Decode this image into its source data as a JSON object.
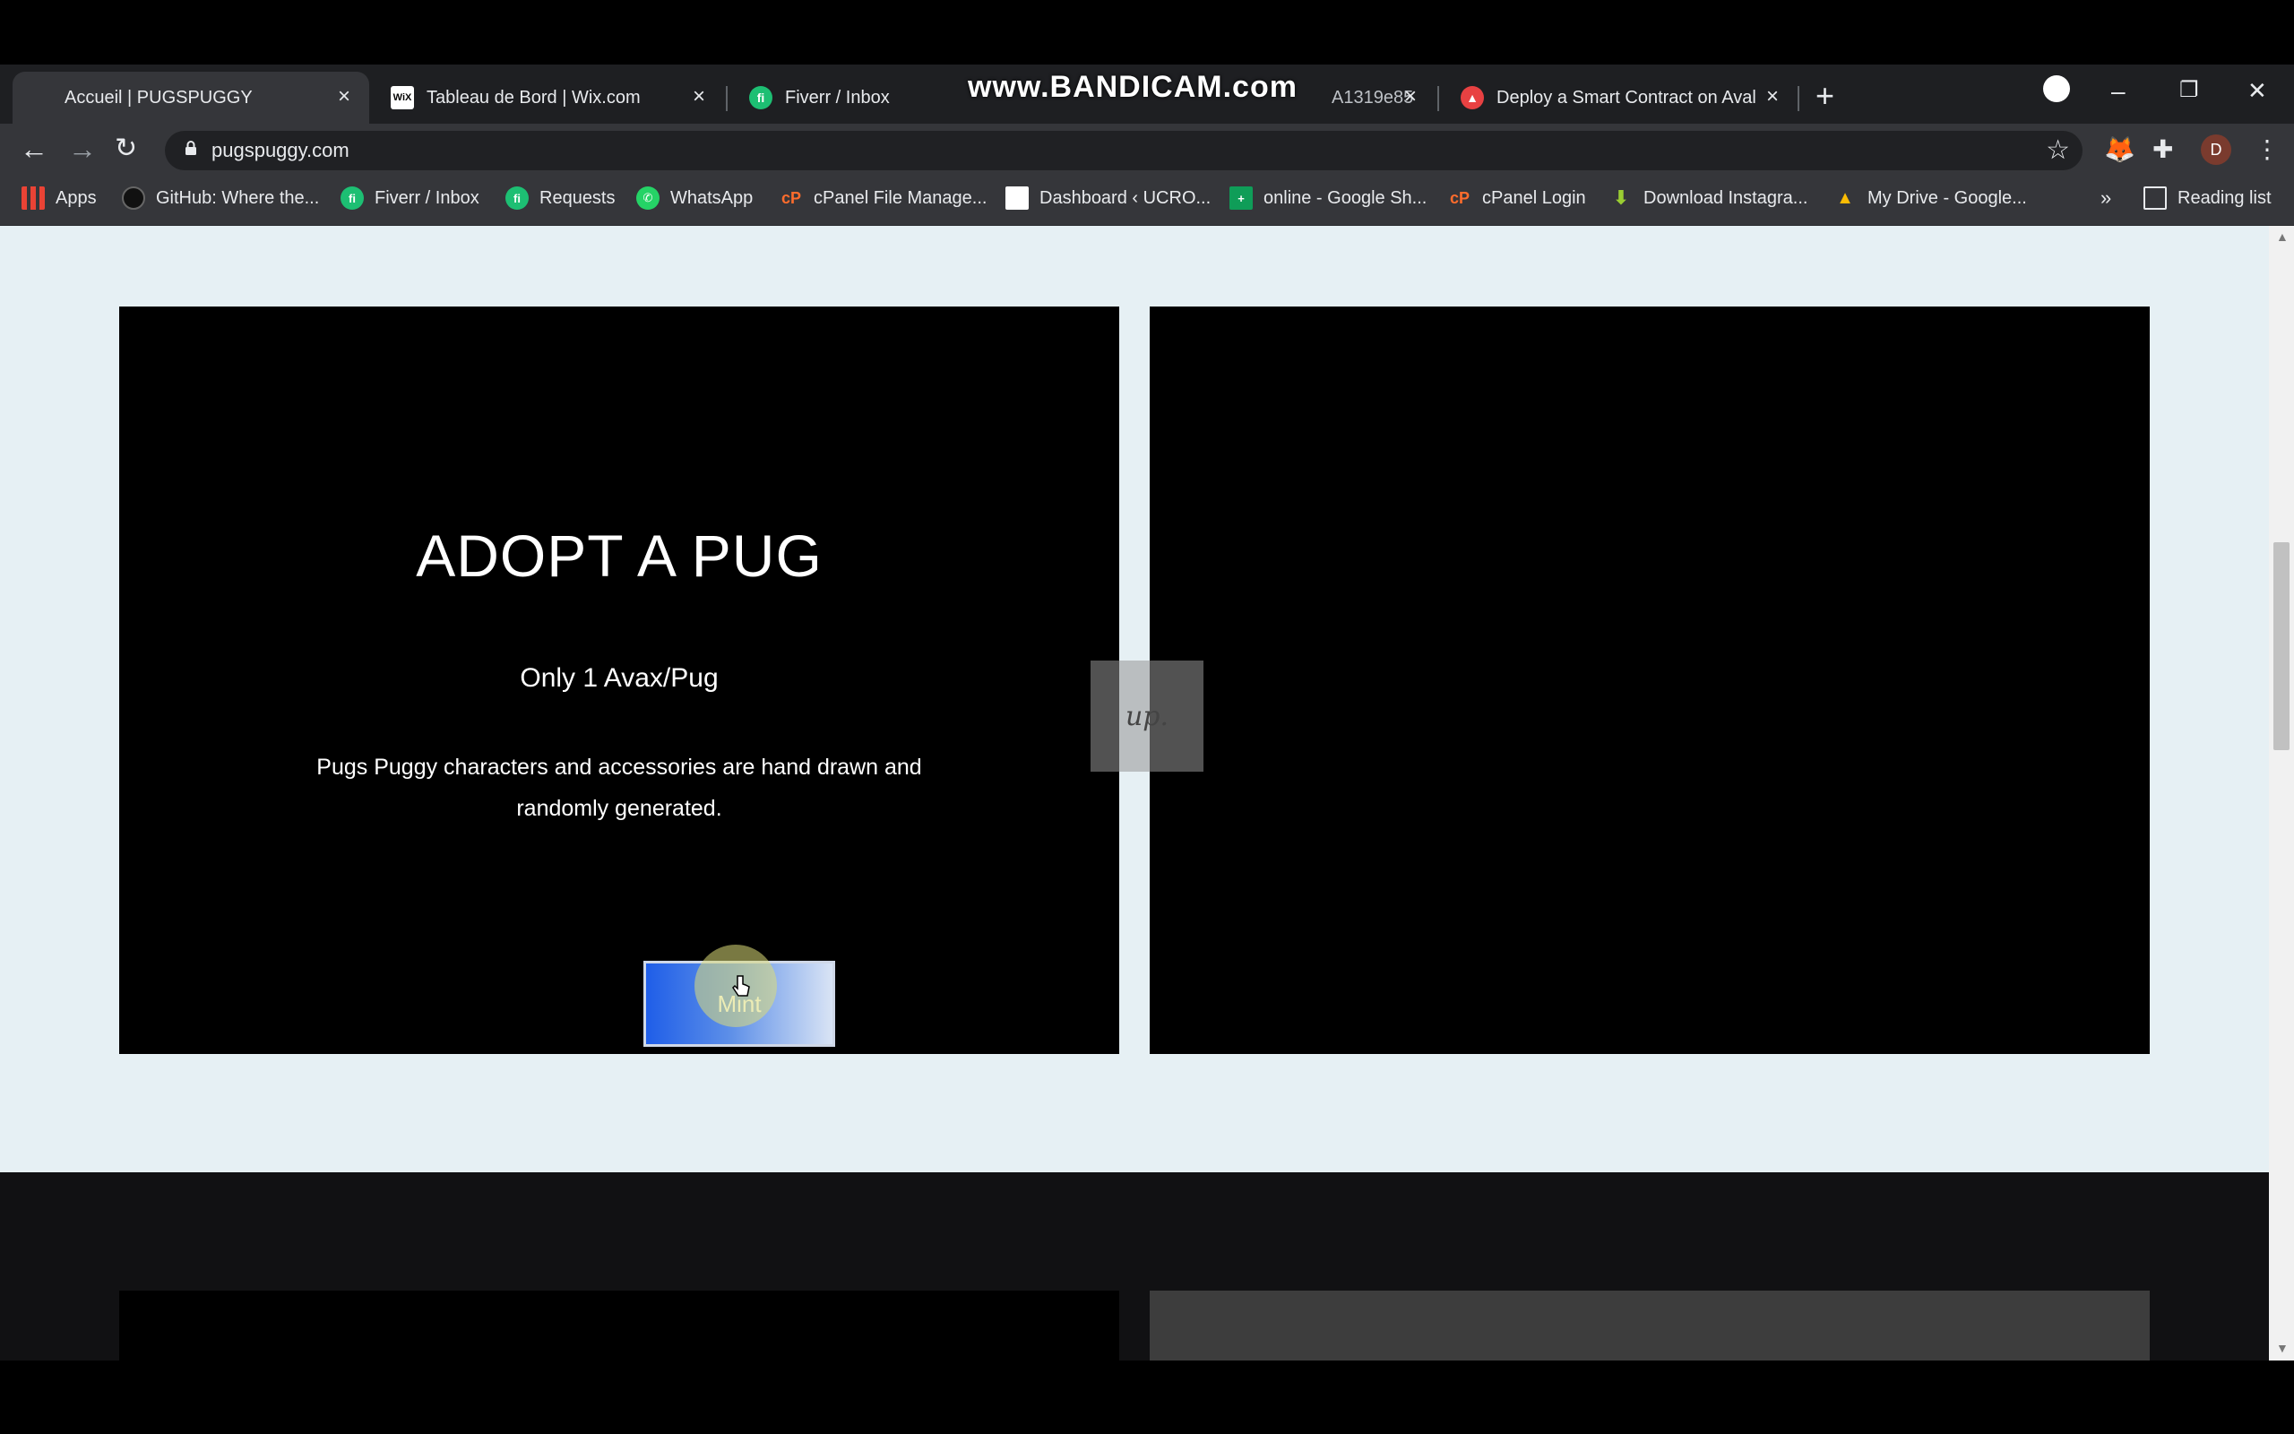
{
  "browser": {
    "tabs": [
      {
        "title": "Accueil | PUGSPUGGY",
        "active": true
      },
      {
        "title": "Tableau de Bord | Wix.com",
        "icon": "wix-icon"
      },
      {
        "title": "Fiverr / Inbox",
        "icon": "fiverr-icon"
      },
      {
        "title": "A1319e85",
        "icon": "tab-icon"
      },
      {
        "title": "Deploy a Smart Contract on Aval",
        "icon": "avalanche-icon"
      }
    ],
    "watermark": "www.BANDICAM.com",
    "new_tab": "+",
    "url": "pugspuggy.com",
    "profile_initial": "D",
    "window_controls": {
      "minimize": "–",
      "restore": "❐",
      "close": "✕"
    }
  },
  "bookmarks": {
    "items": [
      {
        "label": "Apps",
        "icon": "apps-grid-icon"
      },
      {
        "label": "GitHub: Where the...",
        "icon": "github-icon"
      },
      {
        "label": "Fiverr / Inbox",
        "icon": "fiverr-icon"
      },
      {
        "label": "Requests",
        "icon": "fiverr-icon"
      },
      {
        "label": "WhatsApp",
        "icon": "whatsapp-icon"
      },
      {
        "label": "cPanel File Manage...",
        "icon": "cpanel-icon"
      },
      {
        "label": "Dashboard ‹ UCRO...",
        "icon": "document-icon"
      },
      {
        "label": "online - Google Sh...",
        "icon": "google-sheets-icon"
      },
      {
        "label": "cPanel Login",
        "icon": "cpanel-icon"
      },
      {
        "label": "Download Instagra...",
        "icon": "download-icon"
      },
      {
        "label": "My Drive - Google...",
        "icon": "google-drive-icon"
      }
    ],
    "more": "»",
    "reading_list": "Reading list"
  },
  "page": {
    "hero": {
      "heading": "ADOPT A PUG",
      "price": "Only 1 Avax/Pug",
      "description_line1": "Pugs Puggy characters and accessories are hand drawn and",
      "description_line2": "randomly generated.",
      "mint_label": "Mint"
    },
    "wix_badge": "up.",
    "colors": {
      "page_bg": "#e6f0f4",
      "panel_bg": "#000000",
      "pug_bg": "#74d382",
      "mint_blue": "#1f5ee8"
    }
  }
}
